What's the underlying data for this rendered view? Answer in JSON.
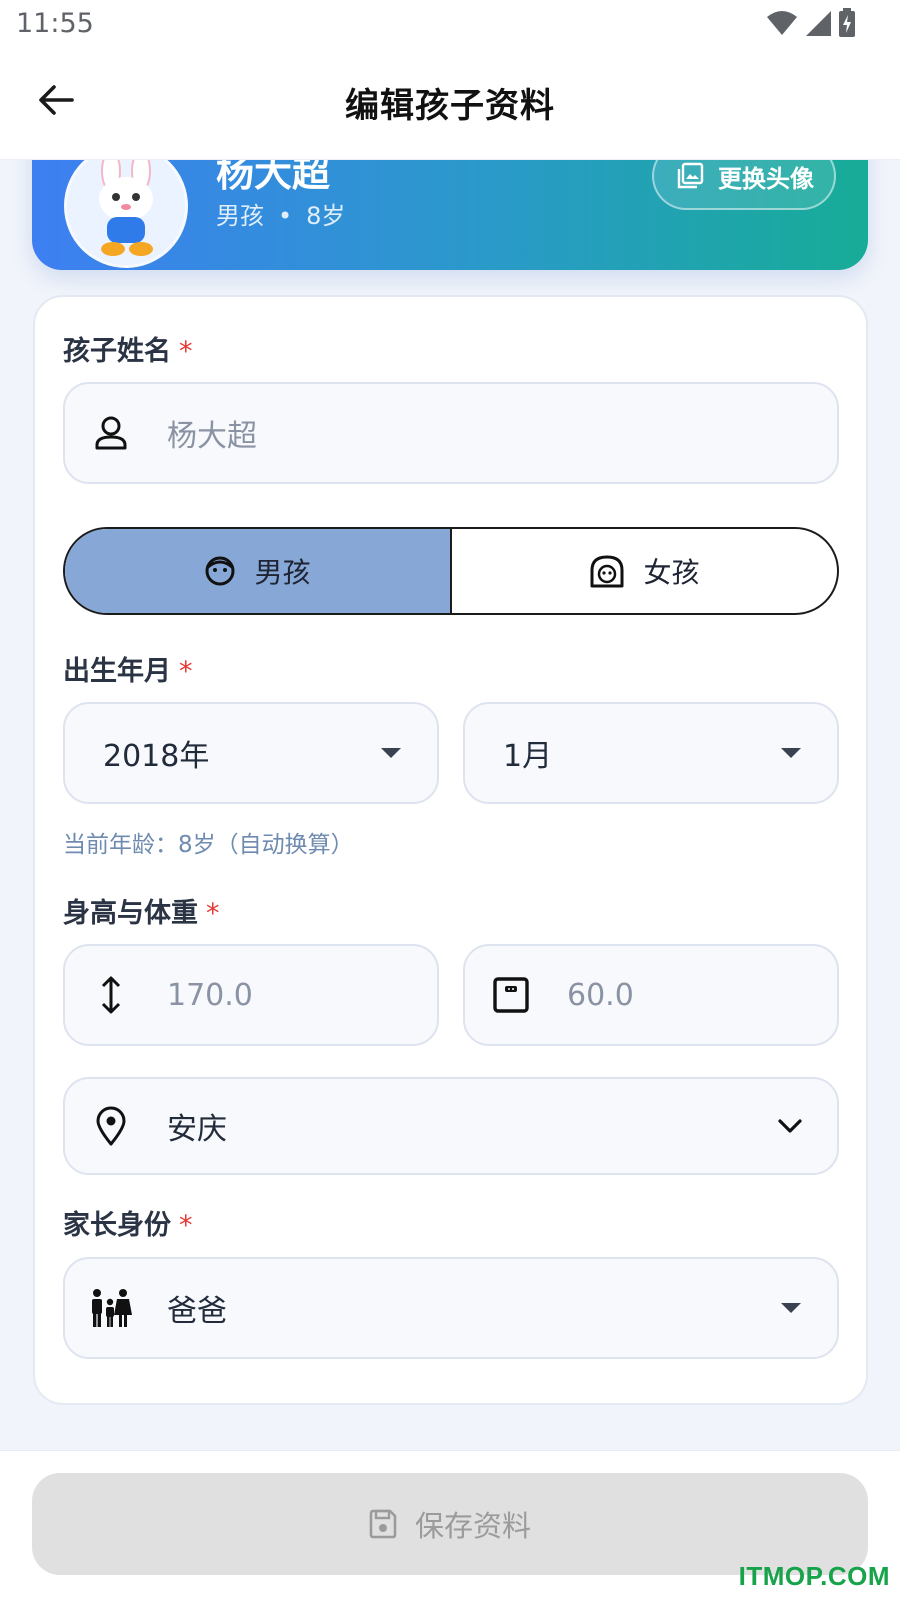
{
  "status_bar": {
    "time": "11:55"
  },
  "header": {
    "title": "编辑孩子资料"
  },
  "profile": {
    "name": "杨大超",
    "gender": "男孩",
    "separator": "•",
    "age": "8岁",
    "change_avatar_label": "更换头像"
  },
  "form": {
    "name_label": "孩子姓名",
    "required_mark": "*",
    "name_placeholder": "杨大超",
    "gender_options": [
      "男孩",
      "女孩"
    ],
    "selected_gender": "男孩",
    "birth_label": "出生年月",
    "birth_year": "2018年",
    "birth_month": "1月",
    "age_hint": "当前年龄：8岁（自动换算）",
    "hw_label": "身高与体重",
    "height_placeholder": "170.0",
    "weight_placeholder": "60.0",
    "city": "安庆",
    "parent_label": "家长身份",
    "parent_role": "爸爸"
  },
  "footer": {
    "save_label": "保存资料"
  },
  "watermark": "ITMOP.COM",
  "colors": {
    "banner_start": "#3d7ff2",
    "banner_end": "#17ac97",
    "gender_active": "#87a8d6",
    "required": "#e53935",
    "hint": "#6f8bb0",
    "watermark": "#16a34a"
  }
}
